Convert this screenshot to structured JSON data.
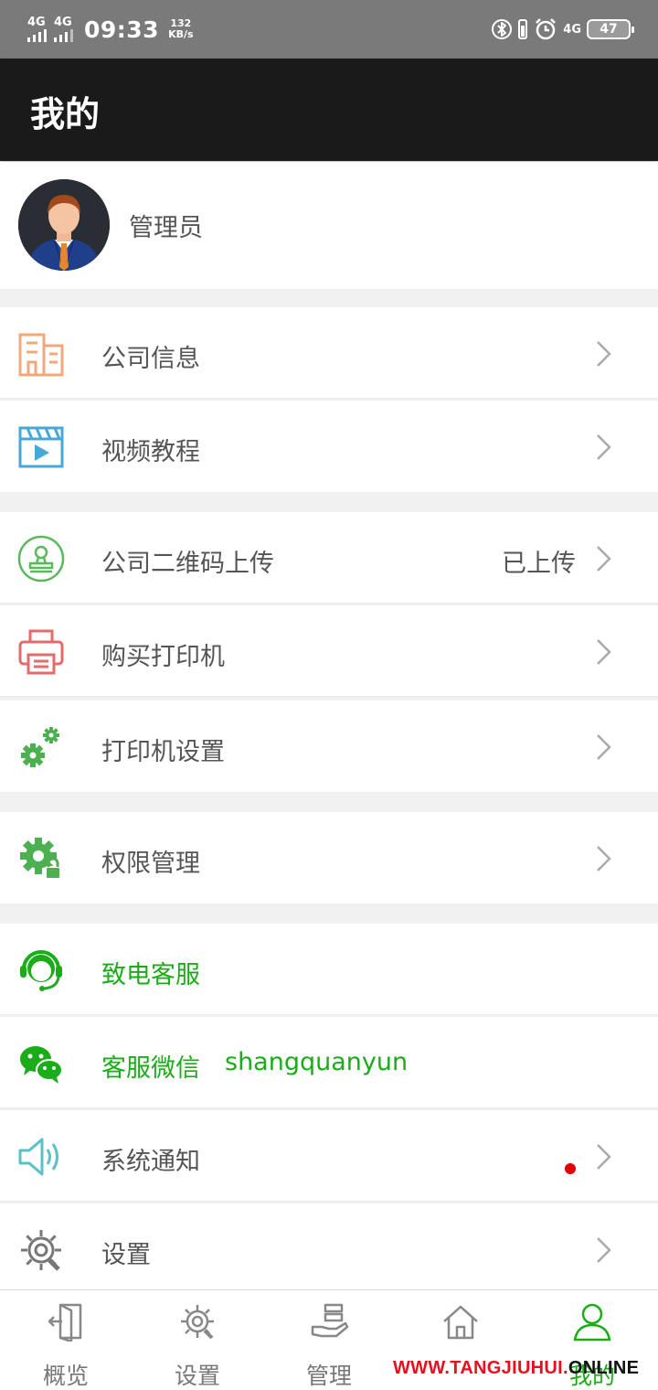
{
  "status_bar": {
    "network_1": "4G",
    "network_2": "4G",
    "time": "09:33",
    "speed_value": "132",
    "speed_unit": "KB/s",
    "network_right": "4G",
    "battery": "47"
  },
  "header": {
    "title": "我的"
  },
  "profile": {
    "name": "管理员"
  },
  "menu": {
    "company_info": {
      "label": "公司信息",
      "icon": "building-icon",
      "color": "#f2a97a"
    },
    "video_tutorial": {
      "label": "视频教程",
      "icon": "video-icon",
      "color": "#47a8d8"
    },
    "qr_upload": {
      "label": "公司二维码上传",
      "status": "已上传",
      "icon": "stamp-icon",
      "color": "#5cb85c"
    },
    "buy_printer": {
      "label": "购买打印机",
      "icon": "printer-icon",
      "color": "#e26b6b"
    },
    "printer_settings": {
      "label": "打印机设置",
      "icon": "gears-icon",
      "color": "#4caf50"
    },
    "permissions": {
      "label": "权限管理",
      "icon": "gear-lock-icon",
      "color": "#4caf50"
    },
    "call_service": {
      "label": "致电客服",
      "icon": "headset-icon",
      "color": "#1aad19"
    },
    "wechat_service": {
      "label": "客服微信",
      "value": "shangquanyun",
      "icon": "wechat-icon",
      "color": "#1aad19"
    },
    "notifications": {
      "label": "系统通知",
      "icon": "speaker-icon",
      "color": "#5bc0c8",
      "unread": true
    },
    "settings": {
      "label": "设置",
      "icon": "gear-icon",
      "color": "#777777"
    }
  },
  "tabs": [
    {
      "label": "概览",
      "icon": "exit-door-icon"
    },
    {
      "label": "设置",
      "icon": "gear-icon"
    },
    {
      "label": "管理",
      "icon": "hand-tray-icon"
    },
    {
      "label": "",
      "icon": "home-icon"
    },
    {
      "label": "我的",
      "icon": "person-icon",
      "active": true
    }
  ],
  "watermark": {
    "part1": "WWW.TANGJIUHUI.",
    "part2": "ONLINE"
  },
  "colors": {
    "accent": "#1aad19",
    "header_bg": "#1a1a1a",
    "status_bg": "#7a7a7a",
    "badge": "#e00000"
  }
}
